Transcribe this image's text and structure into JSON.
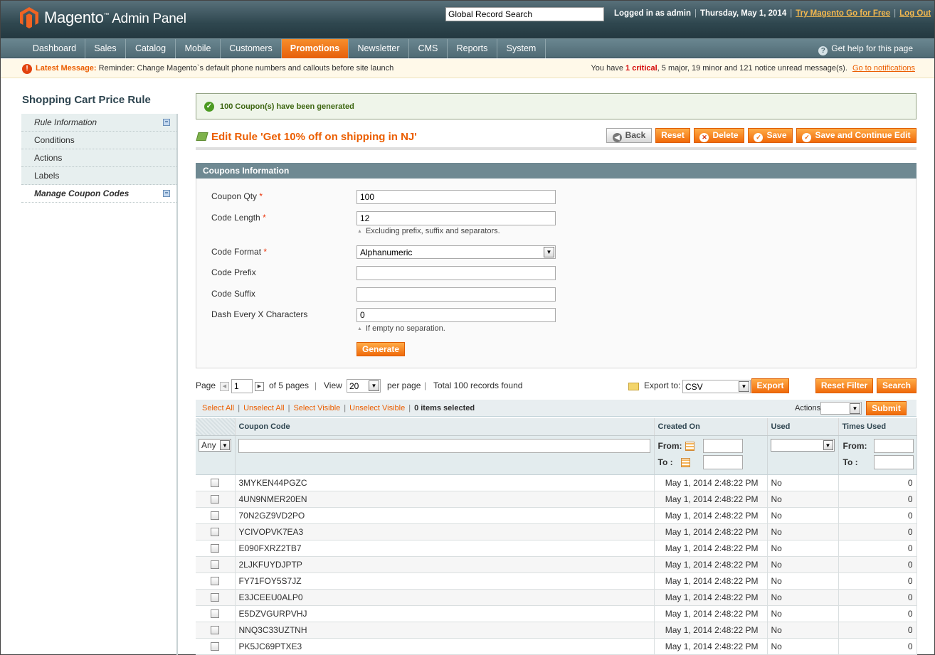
{
  "header": {
    "logo_text": "Magento",
    "logo_tm": "™",
    "logo_sub": "Admin Panel",
    "global_search_placeholder": "Global Record Search",
    "logged_in": "Logged in as admin",
    "date": "Thursday, May 1, 2014",
    "try_link": "Try Magento Go for Free",
    "logout": "Log Out"
  },
  "nav": {
    "items": [
      "Dashboard",
      "Sales",
      "Catalog",
      "Mobile",
      "Customers",
      "Promotions",
      "Newsletter",
      "CMS",
      "Reports",
      "System"
    ],
    "active": "Promotions",
    "help": "Get help for this page"
  },
  "notice": {
    "label": "Latest Message:",
    "message": "Reminder: Change Magento`s default phone numbers and callouts before site launch",
    "summary_pre": "You have",
    "critical": "1 critical",
    "summary_rest": ", 5 major, 19 minor and 121 notice unread message(s).",
    "link": "Go to notifications"
  },
  "sidebar": {
    "title": "Shopping Cart Price Rule",
    "tabs": [
      "Rule Information",
      "Conditions",
      "Actions",
      "Labels",
      "Manage Coupon Codes"
    ]
  },
  "success": "100 Coupon(s) have been generated",
  "page": {
    "title": "Edit Rule 'Get 10% off on shipping in NJ'",
    "buttons": {
      "back": "Back",
      "reset": "Reset",
      "delete": "Delete",
      "save": "Save",
      "save_continue": "Save and Continue Edit"
    }
  },
  "form": {
    "legend": "Coupons Information",
    "coupon_qty_label": "Coupon Qty",
    "coupon_qty": "100",
    "code_length_label": "Code Length",
    "code_length": "12",
    "code_length_note": "Excluding prefix, suffix and separators.",
    "code_format_label": "Code Format",
    "code_format": "Alphanumeric",
    "prefix_label": "Code Prefix",
    "prefix": "",
    "suffix_label": "Code Suffix",
    "suffix": "",
    "dash_label": "Dash Every X Characters",
    "dash": "0",
    "dash_note": "If empty no separation.",
    "generate": "Generate",
    "required_mark": "*"
  },
  "pager": {
    "page_label": "Page",
    "page": "1",
    "of_pages": "of 5 pages",
    "view_label": "View",
    "view": "20",
    "per_page": "per page",
    "total": "Total 100 records found",
    "export_label": "Export to:",
    "export_format": "CSV",
    "export_btn": "Export",
    "reset_filter": "Reset Filter",
    "search": "Search"
  },
  "massaction": {
    "select_all": "Select All",
    "unselect_all": "Unselect All",
    "select_visible": "Select Visible",
    "unselect_visible": "Unselect Visible",
    "selected": "0 items selected",
    "actions_label": "Actions",
    "submit": "Submit"
  },
  "grid": {
    "columns": [
      "Coupon Code",
      "Created On",
      "Used",
      "Times Used"
    ],
    "filter_any": "Any",
    "from": "From:",
    "to": "To :",
    "rows": [
      {
        "code": "3MYKEN44PGZC",
        "created": "May 1, 2014 2:48:22 PM",
        "used": "No",
        "times": "0"
      },
      {
        "code": "4UN9NMER20EN",
        "created": "May 1, 2014 2:48:22 PM",
        "used": "No",
        "times": "0"
      },
      {
        "code": "70N2GZ9VD2PO",
        "created": "May 1, 2014 2:48:22 PM",
        "used": "No",
        "times": "0"
      },
      {
        "code": "YCIVOPVK7EA3",
        "created": "May 1, 2014 2:48:22 PM",
        "used": "No",
        "times": "0"
      },
      {
        "code": "E090FXRZ2TB7",
        "created": "May 1, 2014 2:48:22 PM",
        "used": "No",
        "times": "0"
      },
      {
        "code": "2LJKFUYDJPTP",
        "created": "May 1, 2014 2:48:22 PM",
        "used": "No",
        "times": "0"
      },
      {
        "code": "FY71FOY5S7JZ",
        "created": "May 1, 2014 2:48:22 PM",
        "used": "No",
        "times": "0"
      },
      {
        "code": "E3JCEEU0ALP0",
        "created": "May 1, 2014 2:48:22 PM",
        "used": "No",
        "times": "0"
      },
      {
        "code": "E5DZVGURPVHJ",
        "created": "May 1, 2014 2:48:22 PM",
        "used": "No",
        "times": "0"
      },
      {
        "code": "NNQ3C33UZTNH",
        "created": "May 1, 2014 2:48:22 PM",
        "used": "No",
        "times": "0"
      },
      {
        "code": "PK5JC69PTXE3",
        "created": "May 1, 2014 2:48:22 PM",
        "used": "No",
        "times": "0"
      }
    ]
  }
}
